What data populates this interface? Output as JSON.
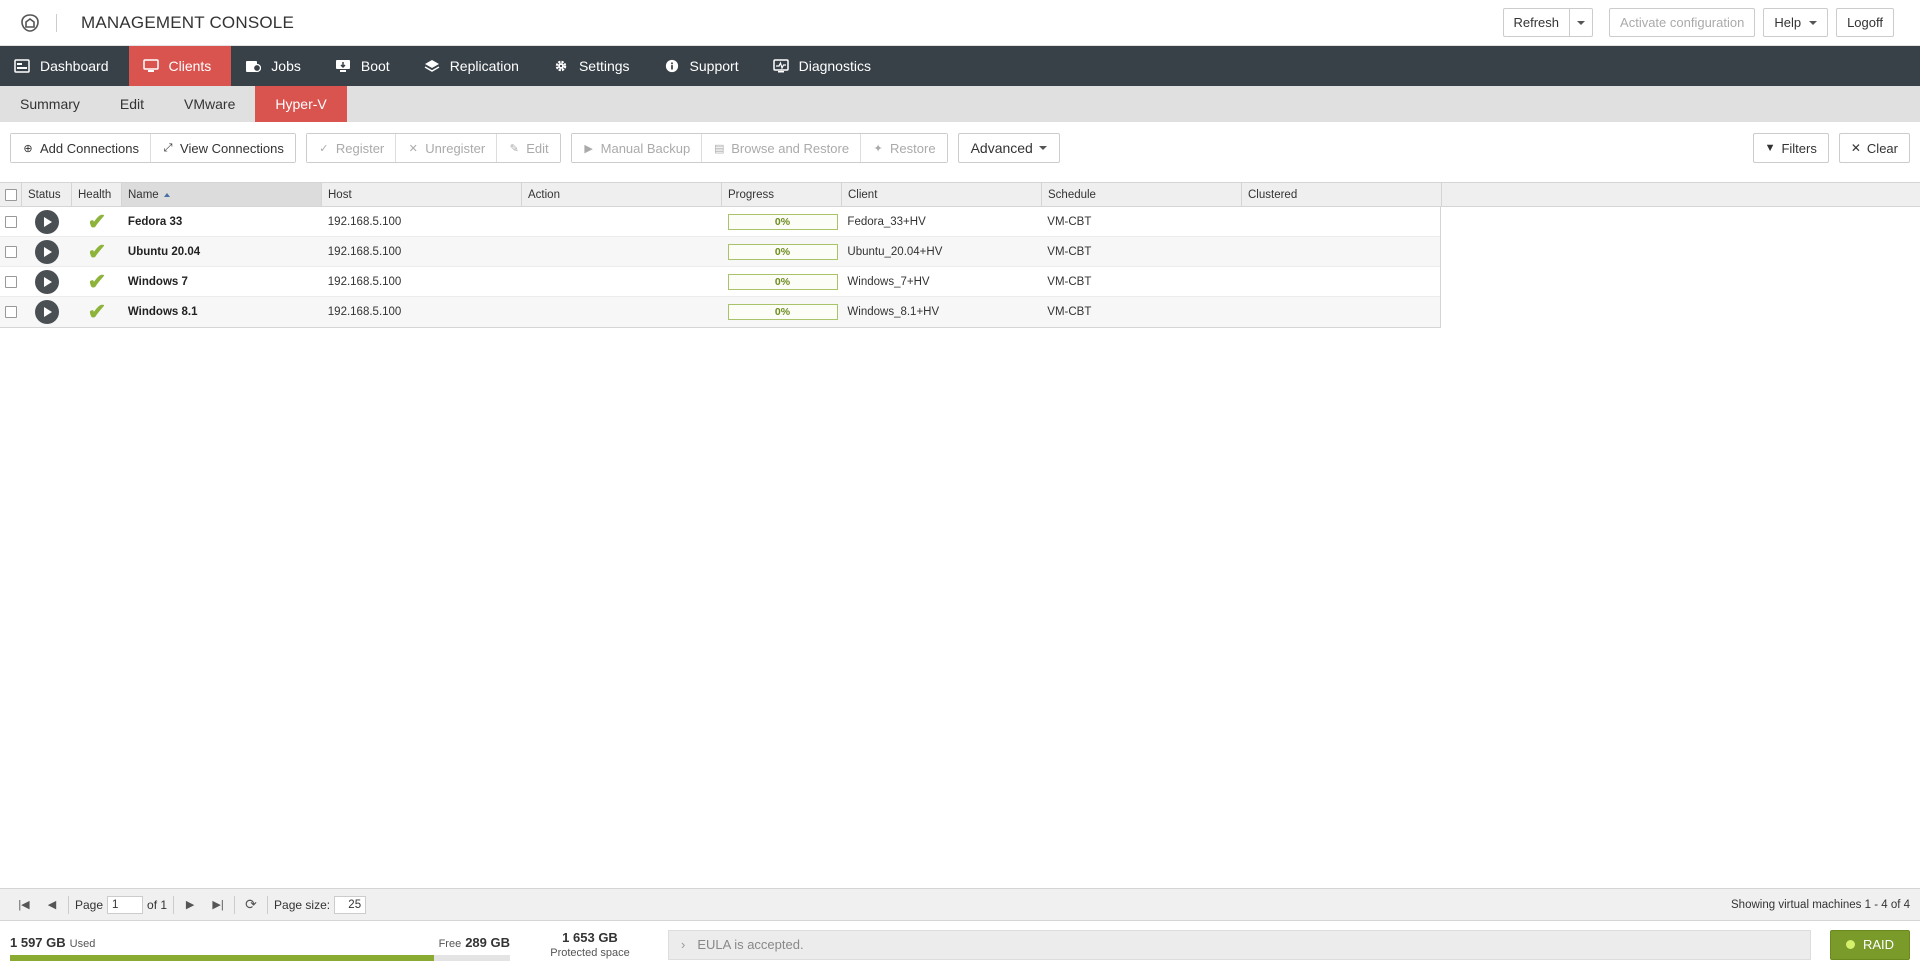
{
  "header": {
    "title": "MANAGEMENT CONSOLE",
    "refresh_label": "Refresh",
    "activate_label": "Activate configuration",
    "help_label": "Help",
    "logoff_label": "Logoff"
  },
  "mainnav": {
    "items": [
      {
        "label": "Dashboard",
        "icon": "dashboard-icon"
      },
      {
        "label": "Clients",
        "icon": "monitor-icon",
        "active": true
      },
      {
        "label": "Jobs",
        "icon": "jobs-icon"
      },
      {
        "label": "Boot",
        "icon": "boot-icon"
      },
      {
        "label": "Replication",
        "icon": "layers-icon"
      },
      {
        "label": "Settings",
        "icon": "gear-icon"
      },
      {
        "label": "Support",
        "icon": "info-icon"
      },
      {
        "label": "Diagnostics",
        "icon": "diagnostics-icon"
      }
    ]
  },
  "subnav": {
    "items": [
      {
        "label": "Summary"
      },
      {
        "label": "Edit"
      },
      {
        "label": "VMware"
      },
      {
        "label": "Hyper-V",
        "active": true
      }
    ]
  },
  "toolbar": {
    "add_connections": "Add Connections",
    "view_connections": "View Connections",
    "register": "Register",
    "unregister": "Unregister",
    "edit": "Edit",
    "manual_backup": "Manual Backup",
    "browse_restore": "Browse and Restore",
    "restore": "Restore",
    "advanced": "Advanced",
    "filters": "Filters",
    "clear": "Clear"
  },
  "grid": {
    "columns": [
      "Status",
      "Health",
      "Name",
      "Host",
      "Action",
      "Progress",
      "Client",
      "Schedule",
      "Clustered"
    ],
    "rows": [
      {
        "name": "Fedora 33",
        "host": "192.168.5.100",
        "action": "",
        "progress": "0%",
        "client": "Fedora_33+HV",
        "schedule": "VM-CBT",
        "clustered": ""
      },
      {
        "name": "Ubuntu 20.04",
        "host": "192.168.5.100",
        "action": "",
        "progress": "0%",
        "client": "Ubuntu_20.04+HV",
        "schedule": "VM-CBT",
        "clustered": ""
      },
      {
        "name": "Windows 7",
        "host": "192.168.5.100",
        "action": "",
        "progress": "0%",
        "client": "Windows_7+HV",
        "schedule": "VM-CBT",
        "clustered": ""
      },
      {
        "name": "Windows 8.1",
        "host": "192.168.5.100",
        "action": "",
        "progress": "0%",
        "client": "Windows_8.1+HV",
        "schedule": "VM-CBT",
        "clustered": ""
      }
    ]
  },
  "pager": {
    "page_label": "Page",
    "page_value": "1",
    "of_label": "of 1",
    "page_size_label": "Page size:",
    "page_size_value": "25",
    "summary": "Showing virtual machines 1 - 4 of 4"
  },
  "footer": {
    "used_value": "1 597 GB",
    "used_label": "Used",
    "free_label": "Free",
    "free_value": "289 GB",
    "used_fraction": 0.847,
    "protected_value": "1 653 GB",
    "protected_label": "Protected space",
    "eula_text": "EULA is accepted.",
    "raid_label": "RAID"
  },
  "colors": {
    "nav_bg": "#384148",
    "accent": "#d9534f",
    "ok_green": "#8db33a",
    "raid_green": "#7a9a2a"
  }
}
